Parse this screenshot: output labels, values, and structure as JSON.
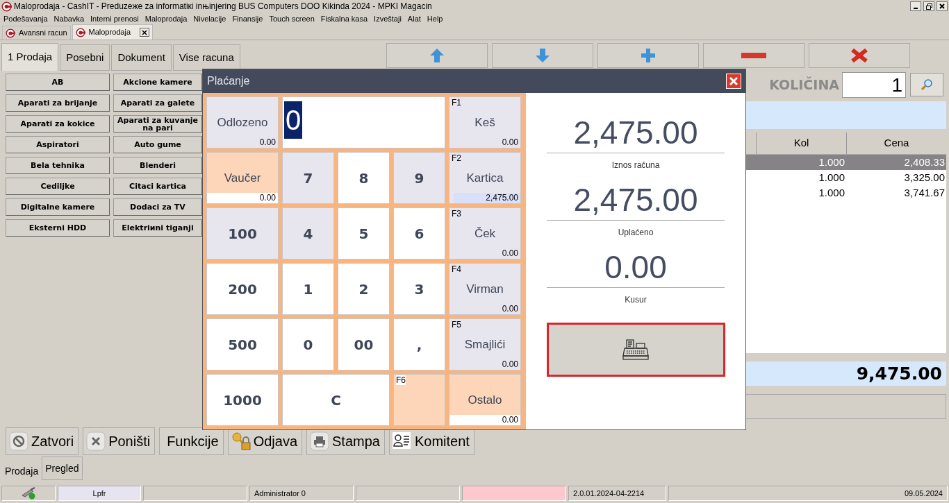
{
  "window": {
    "title": "Maloprodaja - CashIT - Preduzeжe za informatiкi inњinjering BUS Computers DOO Kikinda 2024 - MPKI Magacin"
  },
  "menu": [
    "Podešavanja",
    "Nabavka",
    "Interni prenosi",
    "Maloprodaja",
    "Nivelacije",
    "Finansije",
    "Touch screen",
    "Fiskalna kasa",
    "Izveštaji",
    "Alat",
    "Help"
  ],
  "doc_tabs": [
    {
      "label": "Avansni racun",
      "selected": false,
      "closable": false
    },
    {
      "label": "Maloprodaja",
      "selected": true,
      "closable": true
    }
  ],
  "sale_tabs": [
    {
      "label": "1 Prodaja",
      "selected": true
    },
    {
      "label": "Posebni",
      "selected": false
    },
    {
      "label": "Dokument",
      "selected": false
    },
    {
      "label": "Vise racuna",
      "selected": false
    }
  ],
  "categories": [
    "AB",
    "Akcione kamere",
    "Aparati za brijanje",
    "Aparati za galete",
    "Aparati za kokice",
    "Aparati za kuvanje na pari",
    "Aspiratori",
    "Auto gume",
    "Bela tehnika",
    "Blenderi",
    "Cediljke",
    "Citaci kartica",
    "Digitalne kamere",
    "Dodaci za TV",
    "Eksterni HDD",
    "Elektriиni tiganji"
  ],
  "toolbar": [
    {
      "kind": "up"
    },
    {
      "kind": "down"
    },
    {
      "kind": "add"
    },
    {
      "kind": "remove"
    },
    {
      "kind": "delete"
    }
  ],
  "quantity": {
    "label": "KOLIČINA",
    "value": "1"
  },
  "table": {
    "columns": [
      "Kol",
      "Cena"
    ],
    "rows": [
      {
        "cells": [
          "1.000",
          "2,408.33"
        ],
        "selected": true
      },
      {
        "cells": [
          "1.000",
          "3,325.00"
        ],
        "selected": false
      },
      {
        "cells": [
          "1.000",
          "3,741.67"
        ],
        "selected": false
      }
    ]
  },
  "total": "9,475.00",
  "actions": [
    {
      "label": "Zatvori",
      "kind": "close"
    },
    {
      "label": "Poništi",
      "kind": "cancel"
    },
    {
      "label": "Funkcije",
      "kind": "plain"
    },
    {
      "label": "Odjava",
      "kind": "logout"
    },
    {
      "label": "Stampa",
      "kind": "print"
    },
    {
      "label": "Komitent",
      "kind": "customer"
    }
  ],
  "bottom_tabs": [
    {
      "label": "Prodaja",
      "selected": true
    },
    {
      "label": "Pregled",
      "selected": false
    }
  ],
  "status_bar": [
    {
      "kind": "network"
    },
    {
      "kind": "badge",
      "text": "Lpfr"
    },
    {
      "kind": "blank"
    },
    {
      "kind": "text",
      "text": "Administrator 0"
    },
    {
      "kind": "blank"
    },
    {
      "kind": "alert"
    },
    {
      "kind": "text",
      "text": "2.0.01.2024-04-2214"
    },
    {
      "kind": "date",
      "text": "09.05.2024"
    }
  ],
  "payment": {
    "title": "Plaćanje",
    "keys": [
      {
        "kind": "method",
        "label": "Odlozeno",
        "amount": "0.00",
        "color": "#e7e5ee",
        "boxed_amount": false,
        "selected": false
      },
      {
        "kind": "display",
        "value": "0"
      },
      {
        "kind": "method",
        "fkey": "F1",
        "label": "Keš",
        "amount": "0.00",
        "color": "#e7e5ee",
        "boxed_amount": false,
        "selected": false
      },
      {
        "kind": "method",
        "label": "Vaučer",
        "amount": "0.00",
        "color": "#fdd5b9",
        "boxed_amount": true,
        "selected": false
      },
      {
        "kind": "digit",
        "label": "7",
        "color": "#e7e5ee"
      },
      {
        "kind": "digit",
        "label": "8",
        "color": "#ffffff"
      },
      {
        "kind": "digit",
        "label": "9",
        "color": "#e7e5ee"
      },
      {
        "kind": "method",
        "fkey": "F2",
        "label": "Kartica",
        "amount": "2,475.00",
        "color": "#e7e5ee",
        "boxed_amount": false,
        "selected": true
      },
      {
        "kind": "digit",
        "label": "100",
        "color": "#e7e5ee"
      },
      {
        "kind": "digit",
        "label": "4",
        "color": "#e7e5ee"
      },
      {
        "kind": "digit",
        "label": "5",
        "color": "#ffffff"
      },
      {
        "kind": "digit",
        "label": "6",
        "color": "#ffffff"
      },
      {
        "kind": "method",
        "fkey": "F3",
        "label": "Ček",
        "amount": "0.00",
        "color": "#e7e5ee",
        "boxed_amount": false,
        "selected": false
      },
      {
        "kind": "digit",
        "label": "200",
        "color": "#ffffff"
      },
      {
        "kind": "digit",
        "label": "1",
        "color": "#ffffff"
      },
      {
        "kind": "digit",
        "label": "2",
        "color": "#ffffff"
      },
      {
        "kind": "digit",
        "label": "3",
        "color": "#ffffff"
      },
      {
        "kind": "method",
        "fkey": "F4",
        "label": "Virman",
        "amount": "0.00",
        "color": "#e7e5ee",
        "boxed_amount": false,
        "selected": false
      },
      {
        "kind": "digit",
        "label": "500",
        "color": "#ffffff"
      },
      {
        "kind": "digit",
        "label": "0",
        "color": "#ffffff"
      },
      {
        "kind": "digit",
        "label": "00",
        "color": "#ffffff"
      },
      {
        "kind": "digit",
        "label": ",",
        "color": "#ffffff"
      },
      {
        "kind": "method",
        "fkey": "F5",
        "label": "Smajlići",
        "amount": "0.00",
        "color": "#e7e5ee",
        "boxed_amount": false,
        "selected": false
      },
      {
        "kind": "digit",
        "label": "1000",
        "color": "#ffffff"
      },
      {
        "kind": "wide",
        "label": "C",
        "color": "#ffffff"
      },
      {
        "kind": "blank",
        "fkey": "F6",
        "color": "#fdd5b9"
      },
      {
        "kind": "method",
        "label": "Ostalo",
        "amount": "0.00",
        "color": "#fdd5b9",
        "boxed_amount": true,
        "selected": false
      }
    ],
    "summary": [
      {
        "amount": "2,475.00",
        "label": "Iznos računa"
      },
      {
        "amount": "2,475.00",
        "label": "Uplaćeno"
      },
      {
        "amount": "0.00",
        "label": "Kusur"
      }
    ],
    "fiscal_button": {
      "focused": true
    }
  }
}
